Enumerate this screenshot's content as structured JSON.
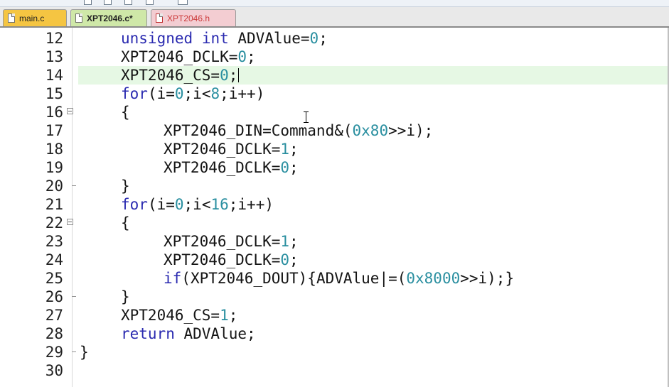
{
  "tabs": [
    {
      "label": "main.c",
      "active": false
    },
    {
      "label": "XPT2046.c*",
      "active": true
    },
    {
      "label": "XPT2046.h",
      "active": false
    }
  ],
  "editor": {
    "highlighted_line": "14",
    "lines": [
      {
        "n": "12",
        "code": "unsigned int ADVAlue=0;"
      },
      {
        "n": "13",
        "code": "XPT2046_DCLK=0;"
      },
      {
        "n": "14",
        "code": "XPT2046_CS=0;"
      },
      {
        "n": "15",
        "code": "for(i=0;i<8;i++)"
      },
      {
        "n": "16",
        "code": "{"
      },
      {
        "n": "17",
        "code": "XPT2046_DIN=Command&(0x80>>i);"
      },
      {
        "n": "18",
        "code": "XPT2046_DCLK=1;"
      },
      {
        "n": "19",
        "code": "XPT2046_DCLK=0;"
      },
      {
        "n": "20",
        "code": "}"
      },
      {
        "n": "21",
        "code": "for(i=0;i<16;i++)"
      },
      {
        "n": "22",
        "code": "{"
      },
      {
        "n": "23",
        "code": "XPT2046_DCLK=1;"
      },
      {
        "n": "24",
        "code": "XPT2046_DCLK=0;"
      },
      {
        "n": "25",
        "code": "if(XPT2046_DOUT){ADVAlue|=(0x8000>>i);}"
      },
      {
        "n": "26",
        "code": "}"
      },
      {
        "n": "27",
        "code": "XPT2046_CS=1;"
      },
      {
        "n": "28",
        "code": "return ADVAlue;"
      },
      {
        "n": "29",
        "code": "}"
      },
      {
        "n": "30",
        "code": ""
      }
    ]
  },
  "colors": {
    "keyword": "#2a2ab0",
    "number": "#2a8fa0",
    "current_line": "#e6f8e4",
    "tab_main": "#f5c542",
    "tab_active": "#cfe8a8",
    "tab_header": "#f3cdd2"
  }
}
